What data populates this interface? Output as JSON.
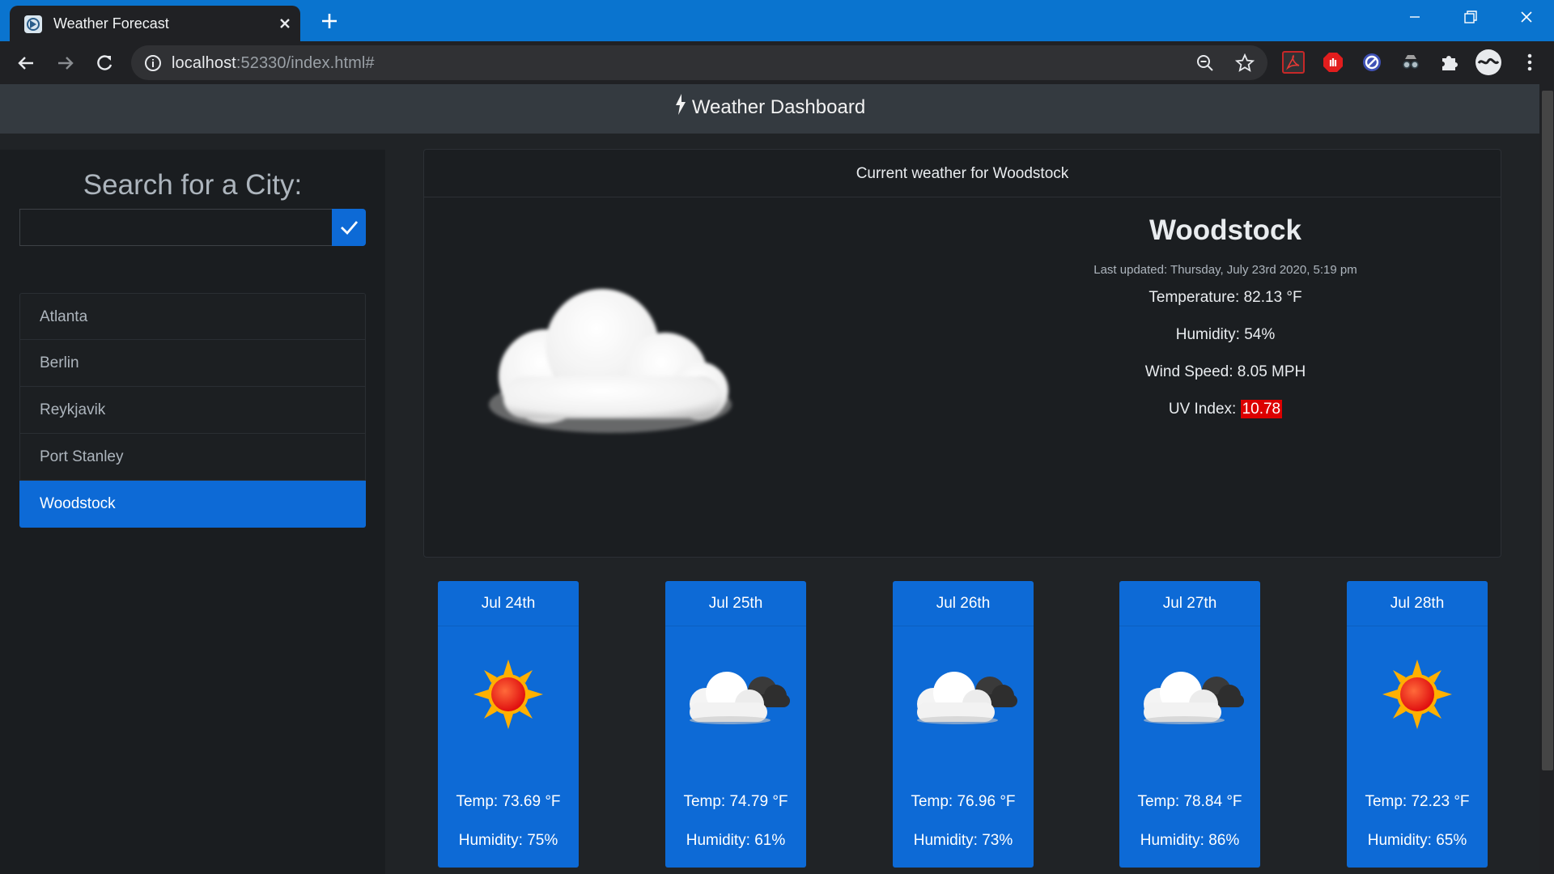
{
  "browser": {
    "tab_title": "Weather Forecast",
    "url_host": "localhost",
    "url_rest": ":52330/index.html#"
  },
  "navbar": {
    "brand": "Weather Dashboard"
  },
  "sidebar": {
    "heading": "Search for a City:",
    "search_value": "",
    "cities": [
      "Atlanta",
      "Berlin",
      "Reykjavik",
      "Port Stanley",
      "Woodstock"
    ],
    "active_city": "Woodstock"
  },
  "current": {
    "header": "Current weather for Woodstock",
    "city": "Woodstock",
    "updated": "Last updated: Thursday, July 23rd 2020, 5:19 pm",
    "temperature": "Temperature: 82.13 °F",
    "humidity": "Humidity: 54%",
    "wind": "Wind Speed: 8.05 MPH",
    "uv_label": "UV Index:",
    "uv_value": "10.78",
    "icon": "cloud-icon"
  },
  "forecast": [
    {
      "date": "Jul 24th",
      "icon": "sun-icon",
      "temp": "Temp: 73.69 °F",
      "humidity": "Humidity: 75%"
    },
    {
      "date": "Jul 25th",
      "icon": "cloud-icon",
      "temp": "Temp: 74.79 °F",
      "humidity": "Humidity: 61%"
    },
    {
      "date": "Jul 26th",
      "icon": "cloud-icon",
      "temp": "Temp: 76.96 °F",
      "humidity": "Humidity: 73%"
    },
    {
      "date": "Jul 27th",
      "icon": "cloud-icon",
      "temp": "Temp: 78.84 °F",
      "humidity": "Humidity: 86%"
    },
    {
      "date": "Jul 28th",
      "icon": "sun-icon",
      "temp": "Temp: 72.23 °F",
      "humidity": "Humidity: 65%"
    }
  ],
  "colors": {
    "accent": "#0d6ad6",
    "uv_high": "#dc0000",
    "navbar": "#343a40",
    "background": "#202326"
  }
}
